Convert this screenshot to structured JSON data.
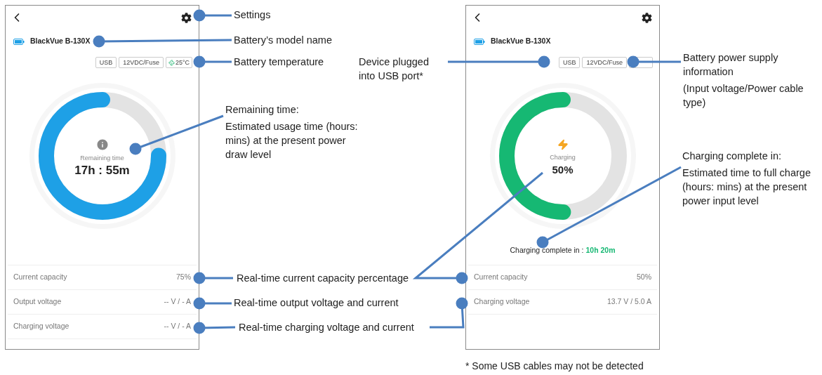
{
  "screens": [
    {
      "model": "BlackVue B-130X",
      "chips": [
        {
          "kind": "text",
          "label": "USB"
        },
        {
          "kind": "text",
          "label": "12VDC/Fuse"
        },
        {
          "kind": "temperature",
          "label": "25°C"
        }
      ],
      "gauge": {
        "kind": "remaining",
        "label": "Remaining time",
        "value": "17h : 55m",
        "level": 0.75
      },
      "rows": [
        {
          "label": "Current capacity",
          "value": "75%"
        },
        {
          "label": "Output voltage",
          "value": "-- V / - A"
        },
        {
          "label": "Charging voltage",
          "value": "-- V / - A"
        }
      ]
    },
    {
      "model": "BlackVue B-130X",
      "chips": [
        {
          "kind": "text",
          "label": "USB"
        },
        {
          "kind": "text",
          "label": "12VDC/Fuse"
        },
        {
          "kind": "covered"
        }
      ],
      "gauge": {
        "kind": "charging",
        "label": "Charging",
        "value": "50%",
        "level": 0.5
      },
      "status": {
        "label": "Charging complete in : ",
        "value": "10h 20m"
      },
      "rows": [
        {
          "label": "Current capacity",
          "value": "50%"
        },
        {
          "label": "Charging voltage",
          "value": "13.7 V / 5.0 A"
        }
      ]
    }
  ],
  "annotations": [
    {
      "title": "Settings"
    },
    {
      "title": "Battery’s model name"
    },
    {
      "title": "Battery temperature"
    },
    {
      "title": "Device plugged into USB port*"
    },
    {
      "title": "Battery power supply information",
      "body": "(Input voltage/Power cable type)"
    },
    {
      "title": "Remaining time:",
      "body": "Estimated usage time (hours: mins) at the present power draw level"
    },
    {
      "title": "Charging complete in:",
      "body": "Estimated time to full charge (hours: mins) at the present power input level"
    },
    {
      "title": "Real-time current capacity percentage"
    },
    {
      "title": "Real-time output voltage and current"
    },
    {
      "title": "Real-time charging voltage and current"
    }
  ],
  "footnote": "* Some USB cables may not be detected"
}
